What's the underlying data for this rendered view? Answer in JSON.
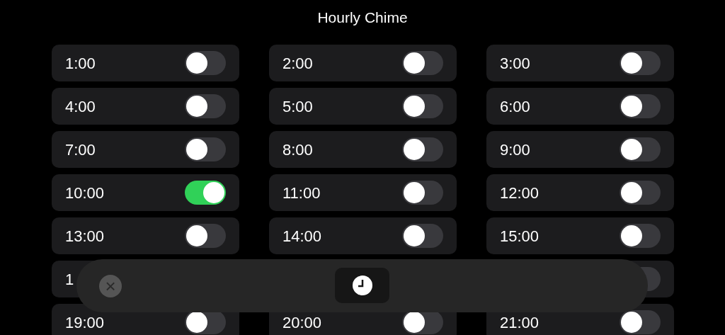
{
  "title": "Hourly Chime",
  "chimes": [
    {
      "label": "1:00",
      "on": false
    },
    {
      "label": "2:00",
      "on": false
    },
    {
      "label": "3:00",
      "on": false
    },
    {
      "label": "4:00",
      "on": false
    },
    {
      "label": "5:00",
      "on": false
    },
    {
      "label": "6:00",
      "on": false
    },
    {
      "label": "7:00",
      "on": false
    },
    {
      "label": "8:00",
      "on": false
    },
    {
      "label": "9:00",
      "on": false
    },
    {
      "label": "10:00",
      "on": true
    },
    {
      "label": "11:00",
      "on": false
    },
    {
      "label": "12:00",
      "on": false
    },
    {
      "label": "13:00",
      "on": false
    },
    {
      "label": "14:00",
      "on": false
    },
    {
      "label": "15:00",
      "on": false
    },
    {
      "label": "1"
    },
    {
      "on": false
    },
    {
      "label": "19:00",
      "on": false
    },
    {
      "label": "20:00",
      "on": false
    },
    {
      "label": "21:00",
      "on": false
    }
  ],
  "overlay": {
    "close": "×"
  }
}
